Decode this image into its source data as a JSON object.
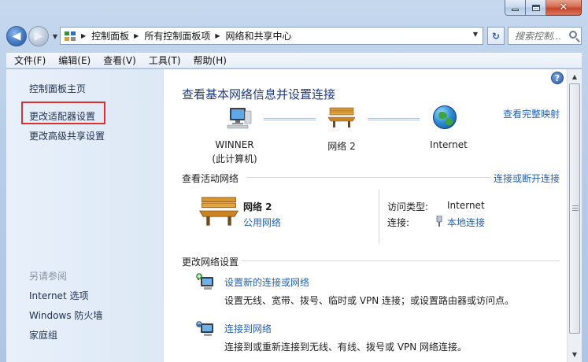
{
  "window": {
    "buttons": {
      "minimize": "–",
      "maximize": "□",
      "close": "✕"
    }
  },
  "address_bar": {
    "crumbs": [
      "控制面板",
      "所有控制面板项",
      "网络和共享中心"
    ],
    "search_placeholder": "搜索控制..."
  },
  "menu": [
    "文件(F)",
    "编辑(E)",
    "查看(V)",
    "工具(T)",
    "帮助(H)"
  ],
  "sidebar": {
    "links": [
      "控制面板主页",
      "更改适配器设置",
      "更改高级共享设置"
    ],
    "see_also_heading": "另请参阅",
    "see_also": [
      "Internet 选项",
      "Windows 防火墙",
      "家庭组"
    ]
  },
  "main": {
    "title": "查看基本网络信息并设置连接",
    "full_map_link": "查看完整映射",
    "map_nodes": [
      {
        "label_line1": "WINNER",
        "label_line2": "(此计算机)",
        "icon": "computer-icon"
      },
      {
        "label_line1": "网络  2",
        "label_line2": "",
        "icon": "bench-icon"
      },
      {
        "label_line1": "Internet",
        "label_line2": "",
        "icon": "globe-icon"
      }
    ],
    "active_networks": {
      "heading": "查看活动网络",
      "connect_link": "连接或断开连接",
      "network_name": "网络  2",
      "network_type_link": "公用网络",
      "access_type_label": "访问类型:",
      "access_type_value": "Internet",
      "connections_label": "连接:",
      "connections_value": "本地连接"
    },
    "change_settings": {
      "heading": "更改网络设置",
      "tasks": [
        {
          "title": "设置新的连接或网络",
          "desc": "设置无线、宽带、拨号、临时或 VPN 连接；或设置路由器或访问点。"
        },
        {
          "title": "连接到网络",
          "desc": "连接到或重新连接到无线、有线、拨号或 VPN 网络连接。"
        }
      ]
    },
    "help_icon": "?"
  },
  "colors": {
    "link": "#1f62c2",
    "title": "#1f3a8a",
    "highlight": "#e0302c",
    "sidebar_bg": "#dde8f6"
  }
}
